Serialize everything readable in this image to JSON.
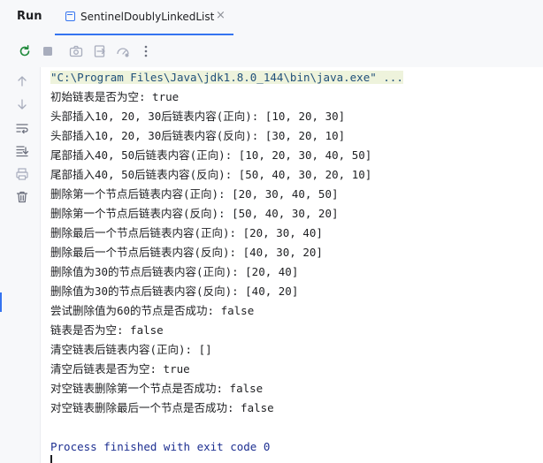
{
  "header": {
    "run_label": "Run",
    "tab_label": "SentinelDoublyLinkedList",
    "tab_close": "×"
  },
  "toolbar": {
    "icons": [
      "rerun-icon",
      "stop-icon",
      "camera-icon",
      "exit-icon",
      "settings-icon",
      "more-icon"
    ]
  },
  "gutter": {
    "icons": [
      "up-arrow-icon",
      "down-arrow-icon",
      "soft-wrap-icon",
      "scroll-to-end-icon",
      "print-icon",
      "trash-icon"
    ]
  },
  "console": {
    "command": "\"C:\\Program Files\\Java\\jdk1.8.0_144\\bin\\java.exe\" ...",
    "lines": [
      "初始链表是否为空: true",
      "头部插入10, 20, 30后链表内容(正向): [10, 20, 30]",
      "头部插入10, 20, 30后链表内容(反向): [30, 20, 10]",
      "尾部插入40, 50后链表内容(正向): [10, 20, 30, 40, 50]",
      "尾部插入40, 50后链表内容(反向): [50, 40, 30, 20, 10]",
      "删除第一个节点后链表内容(正向): [20, 30, 40, 50]",
      "删除第一个节点后链表内容(反向): [50, 40, 30, 20]",
      "删除最后一个节点后链表内容(正向): [20, 30, 40]",
      "删除最后一个节点后链表内容(反向): [40, 30, 20]",
      "删除值为30的节点后链表内容(正向): [20, 40]",
      "删除值为30的节点后链表内容(反向): [40, 20]",
      "尝试删除值为60的节点是否成功: false",
      "链表是否为空: false",
      "清空链表后链表内容(正向): []",
      "清空后链表是否为空: true",
      "对空链表删除第一个节点是否成功: false",
      "对空链表删除最后一个节点是否成功: false"
    ],
    "exit_message": "Process finished with exit code 0"
  },
  "colors": {
    "accent": "#3574f0",
    "panel_bg": "#f7f8fa",
    "command_highlight": "#eef3dc",
    "exit_text": "#1d2f91"
  }
}
